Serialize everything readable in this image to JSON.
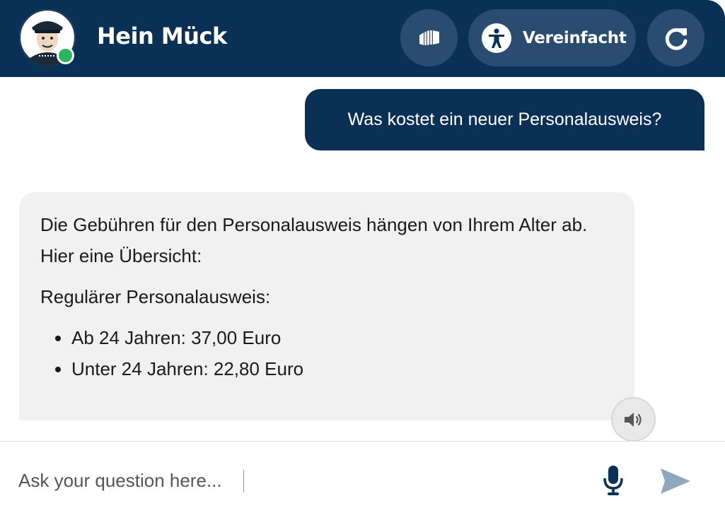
{
  "header": {
    "bot_name": "Hein Mück",
    "simplified_label": "Vereinfacht",
    "icons": {
      "avatar": "avatar-portrait",
      "status": "online-status-dot",
      "accordion": "accordion-icon",
      "accessibility": "accessibility-icon",
      "refresh": "refresh-icon"
    }
  },
  "messages": [
    {
      "role": "user",
      "text": "Was kostet ein neuer Personalausweis?"
    },
    {
      "role": "bot",
      "intro": "Die Gebühren für den Personalausweis hängen von Ihrem Alter ab. Hier eine Übersicht:",
      "subheading": "Regulärer Personalausweis:",
      "items": [
        "Ab 24 Jahren: 37,00 Euro",
        "Unter 24 Jahren: 22,80 Euro"
      ],
      "icon": "speaker-icon"
    }
  ],
  "input": {
    "placeholder": "Ask your question here...",
    "value": "",
    "icons": {
      "mic": "microphone-icon",
      "send": "send-icon"
    }
  },
  "colors": {
    "header_bg": "#0a3055",
    "header_button_bg": "#2a4c70",
    "user_bubble_bg": "#0a3055",
    "bot_bubble_bg": "#f1f1f1",
    "status_green": "#2ab55f",
    "send_icon": "#8fa8bf"
  }
}
